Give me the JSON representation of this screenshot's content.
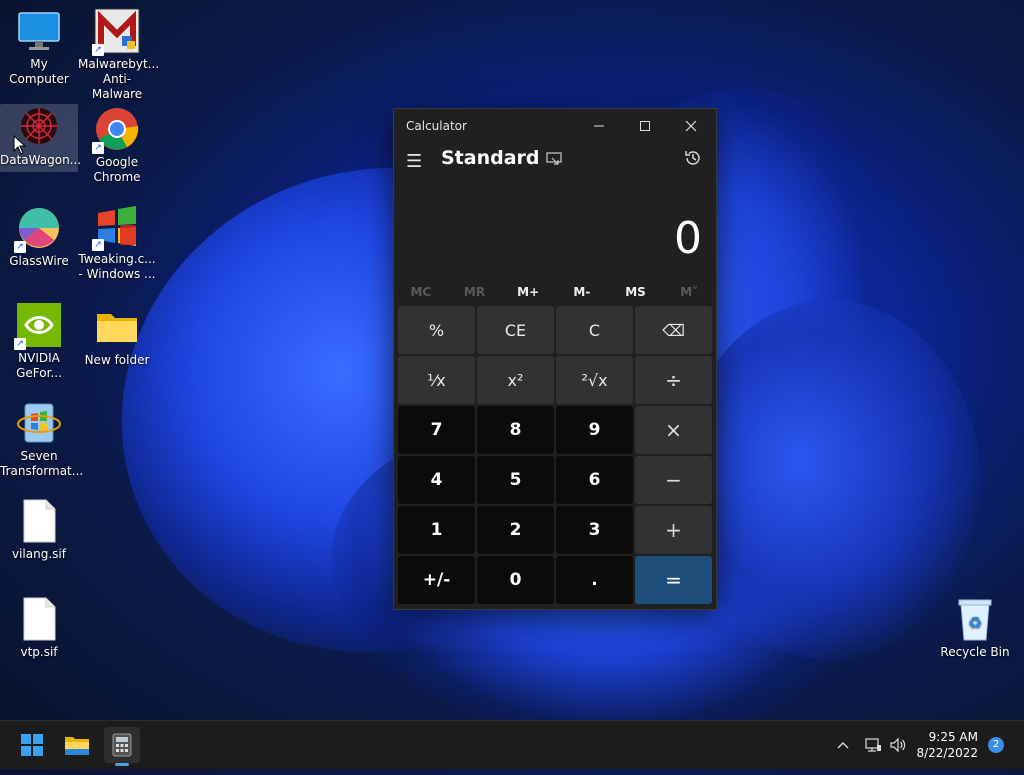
{
  "desktop": {
    "icons": [
      {
        "label": "My Computer"
      },
      {
        "label": "Malwarebyt... Anti-Malware"
      },
      {
        "label": "DataWagon..."
      },
      {
        "label": "Google Chrome"
      },
      {
        "label": "GlassWire"
      },
      {
        "label": "Tweaking.c... - Windows ..."
      },
      {
        "label": "NVIDIA GeFor..."
      },
      {
        "label": "New folder"
      },
      {
        "label": "Seven Transformat..."
      },
      {
        "label": "vilang.sif"
      },
      {
        "label": "vtp.sif"
      },
      {
        "label": "Recycle Bin"
      }
    ]
  },
  "calculator": {
    "window_title": "Calculator",
    "mode": "Standard",
    "display": "0",
    "memory": [
      "MC",
      "MR",
      "M+",
      "M-",
      "MS",
      "M˅"
    ],
    "keys": [
      "%",
      "CE",
      "C",
      "⌫",
      "¹⁄x",
      "x²",
      "²√x",
      "÷",
      "7",
      "8",
      "9",
      "×",
      "4",
      "5",
      "6",
      "−",
      "1",
      "2",
      "3",
      "+",
      "+/-",
      "0",
      ".",
      "="
    ]
  },
  "taskbar": {
    "time": "9:25 AM",
    "date": "8/22/2022",
    "notification_count": "2"
  },
  "colors": {
    "accent_equals": "#1e4f7a",
    "taskbar_indicator": "#4ca0e0"
  }
}
